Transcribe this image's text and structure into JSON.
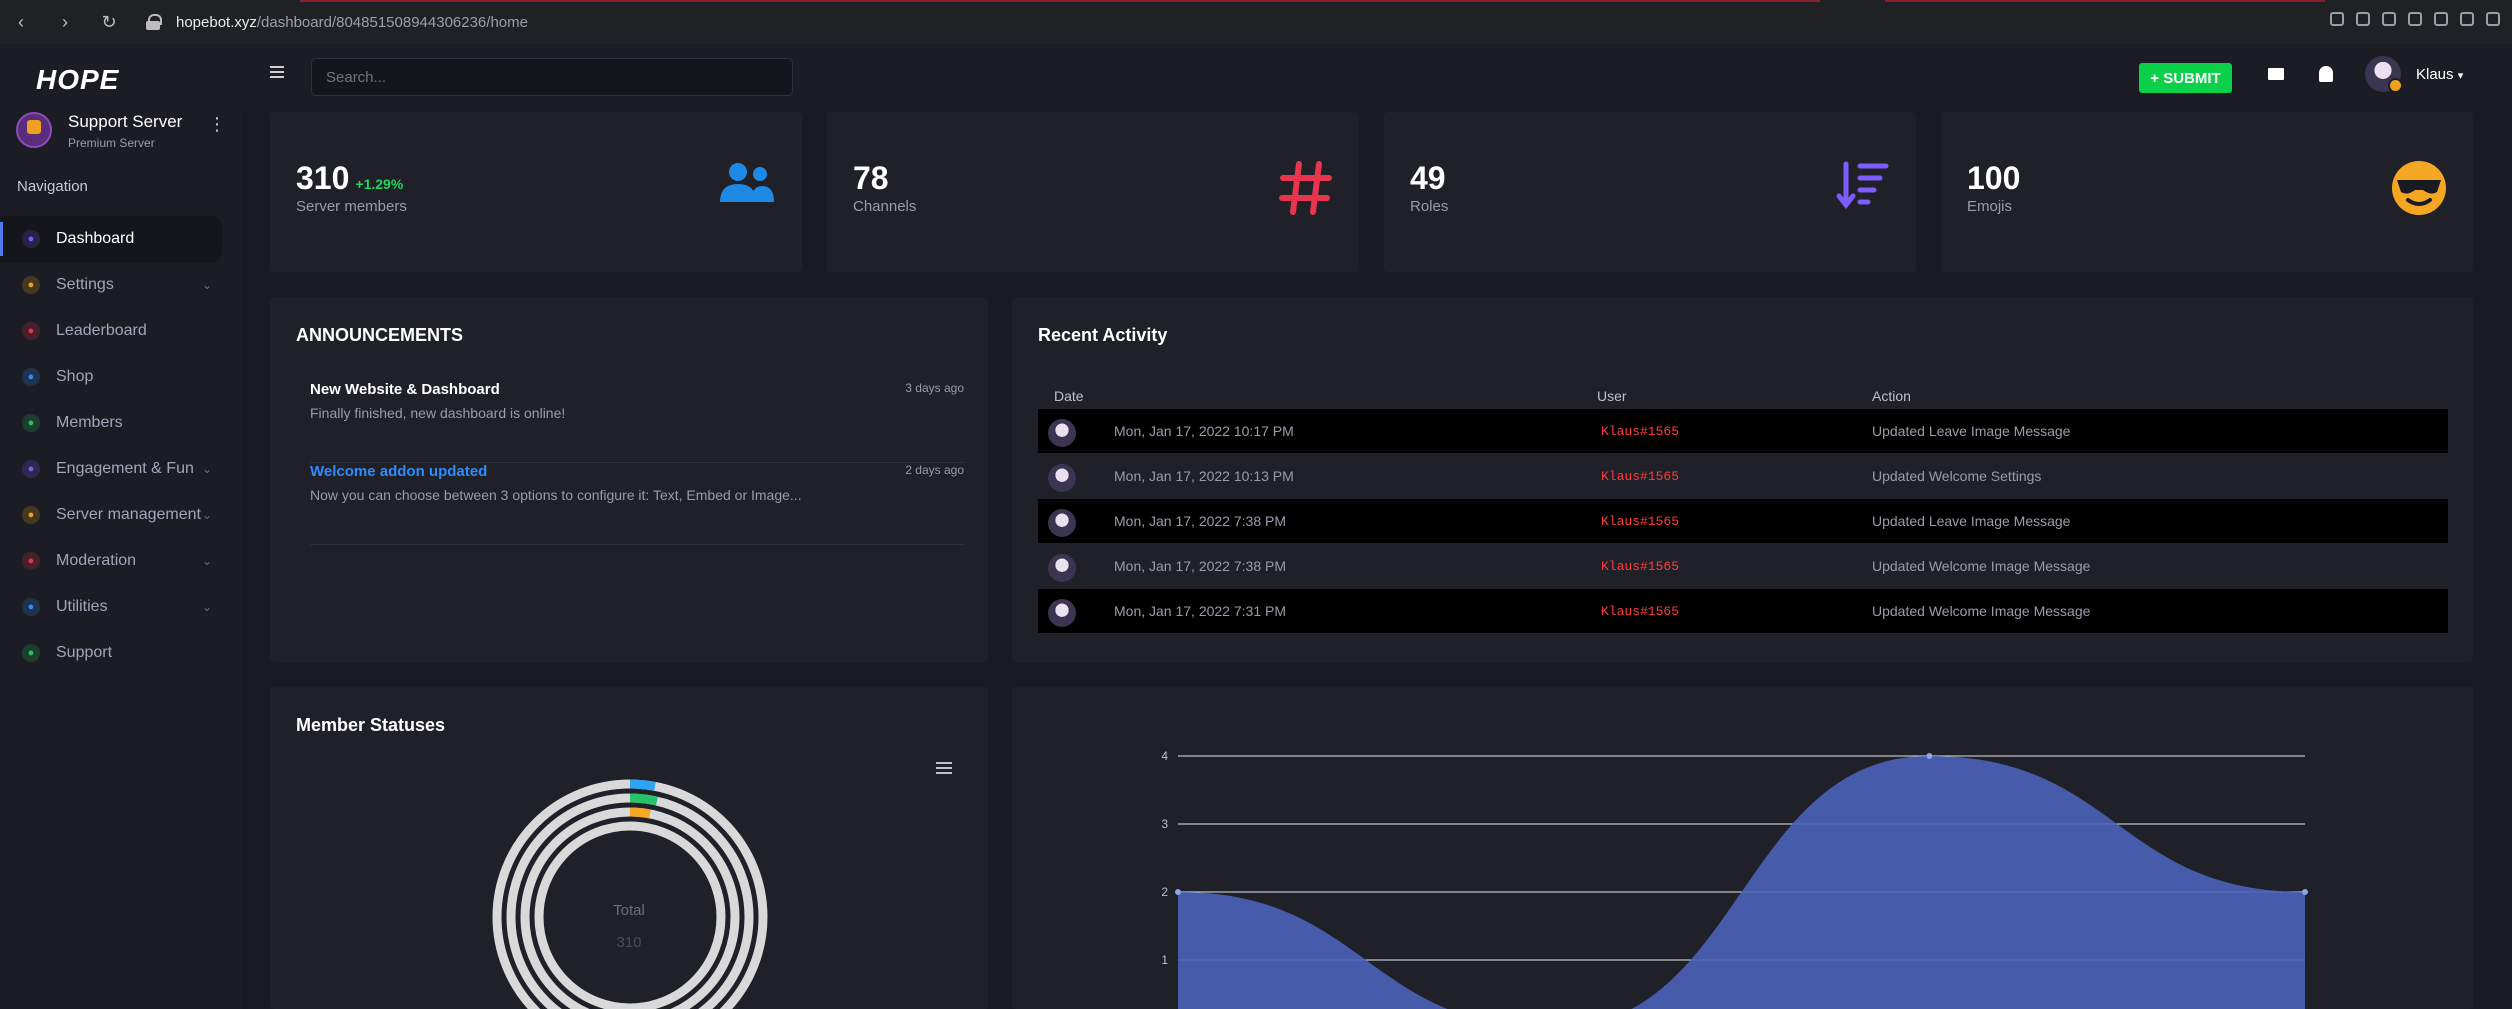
{
  "browser": {
    "url_host": "hopebot.xyz",
    "url_path": "/dashboard/804851508944306236/home"
  },
  "app": {
    "logo": "HOPE"
  },
  "server": {
    "name": "Support Server",
    "type": "Premium Server"
  },
  "sidebar": {
    "heading": "Navigation",
    "items": [
      {
        "label": "Dashboard",
        "icon": "dashboard-icon",
        "color": "#7c5cff",
        "active": true
      },
      {
        "label": "Settings",
        "icon": "gear-icon",
        "color": "#f0a020",
        "chevron": true
      },
      {
        "label": "Leaderboard",
        "icon": "trophy-icon",
        "color": "#e8344d"
      },
      {
        "label": "Shop",
        "icon": "shopping-bag-icon",
        "color": "#2e8cff"
      },
      {
        "label": "Members",
        "icon": "users-icon",
        "color": "#22c55e"
      },
      {
        "label": "Engagement & Fun",
        "icon": "chat-icon",
        "color": "#7c5cff",
        "chevron": true
      },
      {
        "label": "Server management",
        "icon": "server-icon",
        "color": "#f0a020",
        "chevron": true
      },
      {
        "label": "Moderation",
        "icon": "shield-icon",
        "color": "#e8344d",
        "chevron": true
      },
      {
        "label": "Utilities",
        "icon": "tools-icon",
        "color": "#2e8cff",
        "chevron": true
      },
      {
        "label": "Support",
        "icon": "question-icon",
        "color": "#22c55e"
      }
    ]
  },
  "topbar": {
    "search_placeholder": "Search...",
    "submit_label": "+ SUBMIT",
    "username": "Klaus"
  },
  "stats": [
    {
      "value": "310",
      "delta": "+1.29%",
      "label": "Server members",
      "icon": "users-icon",
      "color": "#1e88e5"
    },
    {
      "value": "78",
      "label": "Channels",
      "icon": "hashtag-icon",
      "color": "#e8344d"
    },
    {
      "value": "49",
      "label": "Roles",
      "icon": "sort-icon",
      "color": "#7c5cff"
    },
    {
      "value": "100",
      "label": "Emojis",
      "icon": "sunglasses-emoji-icon",
      "color": "#f5a623"
    }
  ],
  "announcements": {
    "title": "ANNOUNCEMENTS",
    "items": [
      {
        "title": "New Website & Dashboard",
        "desc": "Finally finished, new dashboard is online!",
        "ago": "3 days ago"
      },
      {
        "title": "Welcome addon updated",
        "desc": "Now you can choose between 3 options to configure it: Text, Embed or Image...",
        "ago": "2 days ago"
      }
    ]
  },
  "activity": {
    "title": "Recent Activity",
    "columns": [
      "Date",
      "User",
      "Action"
    ],
    "rows": [
      {
        "date": "Mon, Jan 17, 2022 10:17 PM",
        "user": "Klaus#1565",
        "action": "Updated Leave Image Message"
      },
      {
        "date": "Mon, Jan 17, 2022 10:13 PM",
        "user": "Klaus#1565",
        "action": "Updated Welcome Settings"
      },
      {
        "date": "Mon, Jan 17, 2022 7:38 PM",
        "user": "Klaus#1565",
        "action": "Updated Leave Image Message"
      },
      {
        "date": "Mon, Jan 17, 2022 7:38 PM",
        "user": "Klaus#1565",
        "action": "Updated Welcome Image Message"
      },
      {
        "date": "Mon, Jan 17, 2022 7:31 PM",
        "user": "Klaus#1565",
        "action": "Updated Welcome Image Message"
      }
    ]
  },
  "member_statuses": {
    "title": "Member Statuses",
    "total_label": "Total",
    "total_value": "310"
  },
  "chart_data": {
    "type": "area",
    "ylim": [
      0,
      4
    ],
    "yticks": [
      "1",
      "2",
      "3",
      "4"
    ],
    "x": [
      0,
      1,
      2,
      3
    ],
    "values": [
      2,
      0,
      4,
      2
    ],
    "color": "#4a63b8"
  }
}
